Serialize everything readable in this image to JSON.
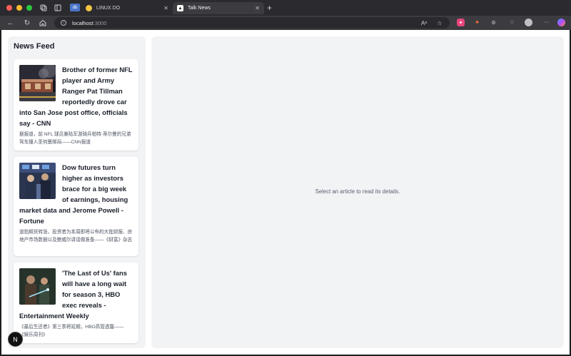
{
  "window": {
    "traffic_lights": [
      "#ff5f57",
      "#febc2e",
      "#28c840"
    ]
  },
  "tabs": [
    {
      "label": "LINUX DO",
      "active": false
    },
    {
      "label": "Talk News",
      "active": true
    }
  ],
  "address_bar": {
    "host": "localhost",
    "port": ":3000"
  },
  "sidebar": {
    "title": "News Feed",
    "articles": [
      {
        "title": "Brother of former NFL player and Army Ranger Pat Tillman reportedly drove car into San Jose post office, officials say - CNN",
        "summary": "据报道，前 NFL 球员兼陆军游骑兵帕特·蒂尔曼的兄弟驾车撞入圣何塞邮局——CNN报道"
      },
      {
        "title": "Dow futures turn higher as investors brace for a big week of earnings, housing market data and Jerome Powell - Fortune",
        "summary": "道指期货转涨，投资者为本周即将公布的大批财报、房地产市场数据以及鲍威尔讲话做准备——《财富》杂志"
      },
      {
        "title": "'The Last of Us' fans will have a long wait for season 3, HBO exec reveals - Entertainment Weekly",
        "summary": "《最后生还者》第三季将延期，HBO高管透露——《娱乐周刊》"
      }
    ]
  },
  "main": {
    "placeholder": "Select an article to read its details."
  },
  "dev_badge": {
    "label": "N"
  }
}
